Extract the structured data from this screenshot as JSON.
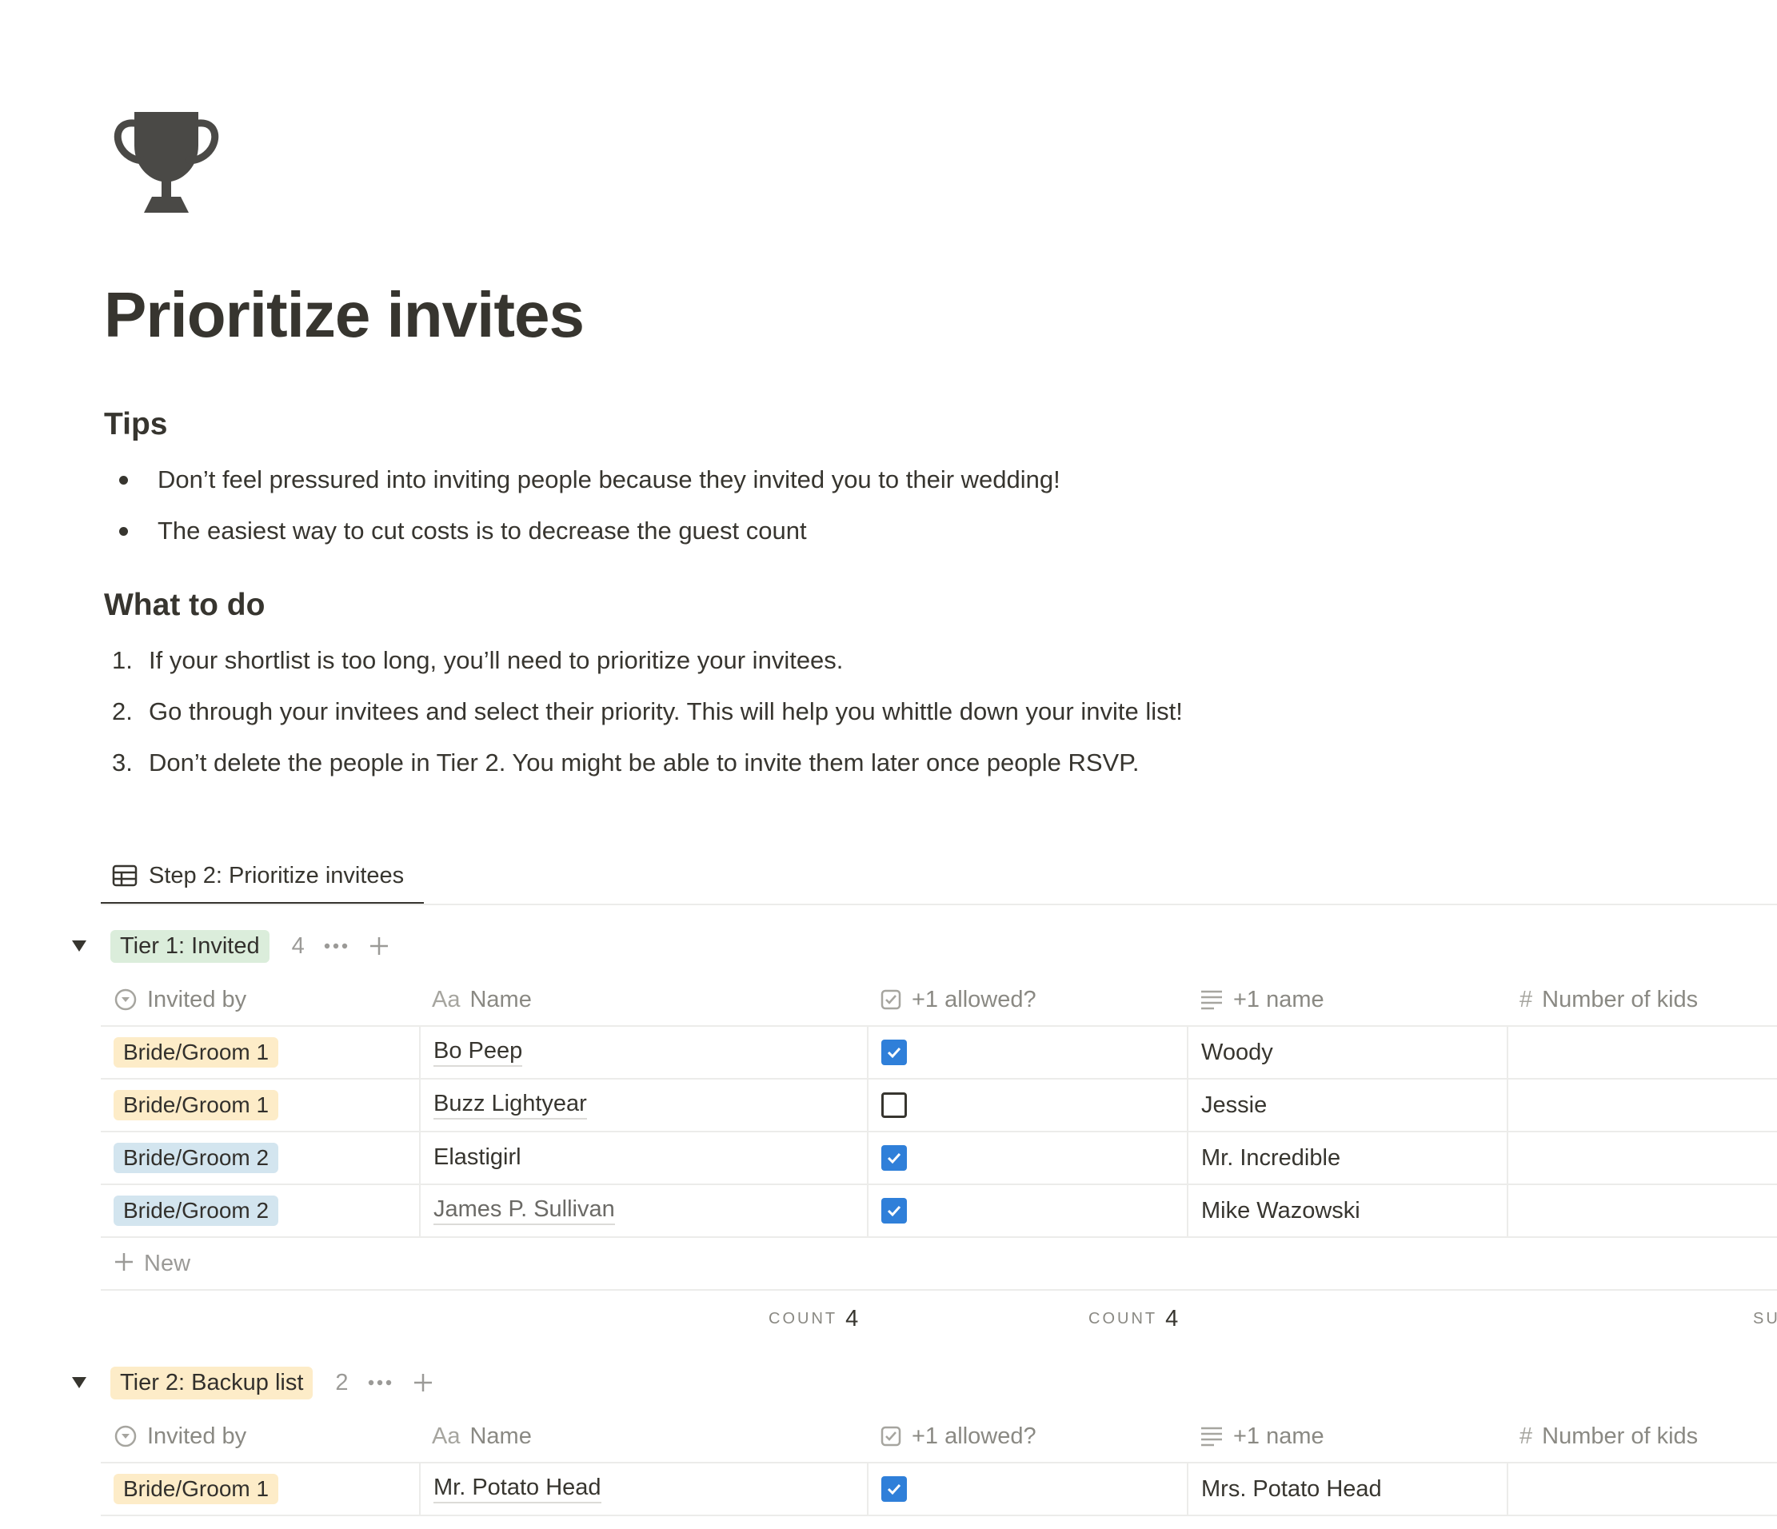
{
  "page": {
    "icon": "trophy-icon",
    "title": "Prioritize invites"
  },
  "tips": {
    "heading": "Tips",
    "items": [
      "Don’t feel pressured into inviting people because they invited you to their wedding!",
      "The easiest way to cut costs is to decrease the guest count"
    ]
  },
  "todo": {
    "heading": "What to do",
    "items": [
      {
        "marker": "1.",
        "text": "If your shortlist is too long, you’ll need to prioritize your invitees."
      },
      {
        "marker": "2.",
        "text": "Go through your invitees and select their priority. This will help you whittle down your invite list!"
      },
      {
        "marker": "3.",
        "text": "Don’t delete the people in Tier 2. You might be able to invite them later once people RSVP."
      }
    ]
  },
  "database": {
    "view_tab": "Step 2: Prioritize invitees",
    "view_icon": "table-icon",
    "columns": [
      {
        "icon": "select-icon",
        "icon_prefix": "",
        "label": "Invited by"
      },
      {
        "icon": "text-type-icon",
        "icon_prefix": "Aa",
        "label": "Name"
      },
      {
        "icon": "checkbox-icon",
        "icon_prefix": "",
        "label": "+1 allowed?"
      },
      {
        "icon": "lines-icon",
        "icon_prefix": "",
        "label": "+1 name"
      },
      {
        "icon": "hash-icon",
        "icon_prefix": "#",
        "label": "Number of kids"
      }
    ],
    "groups": [
      {
        "label": "Tier 1: Invited",
        "color": "#dbeddb",
        "count": "4",
        "rows": [
          {
            "invited_by": "Bride/Groom 1",
            "tag_color": "#fdecc8",
            "name": "Bo Peep",
            "plus_one": true,
            "plus_one_name": "Woody",
            "kids": ""
          },
          {
            "invited_by": "Bride/Groom 1",
            "tag_color": "#fdecc8",
            "name": "Buzz Lightyear",
            "plus_one": false,
            "plus_one_name": "Jessie",
            "kids": ""
          },
          {
            "invited_by": "Bride/Groom 2",
            "tag_color": "#d3e5ef",
            "name": "Elastigirl",
            "plus_one": true,
            "plus_one_name": "Mr. Incredible",
            "kids": ""
          },
          {
            "invited_by": "Bride/Groom 2",
            "tag_color": "#d3e5ef",
            "name": "James P. Sullivan",
            "plus_one": true,
            "plus_one_name": "Mike Wazowski",
            "kids": ""
          }
        ],
        "new_label": "New",
        "summaries": [
          {
            "label": "COUNT",
            "value": "4"
          },
          {
            "label": "COUNT",
            "value": "4"
          },
          {
            "label": "SU",
            "value": ""
          }
        ]
      },
      {
        "label": "Tier 2: Backup list",
        "color": "#fdecc8",
        "count": "2",
        "rows": [
          {
            "invited_by": "Bride/Groom 1",
            "tag_color": "#fdecc8",
            "name": "Mr. Potato Head",
            "plus_one": true,
            "plus_one_name": "Mrs. Potato Head",
            "kids": ""
          }
        ]
      }
    ]
  },
  "colors": {
    "text": "#37352f",
    "muted": "#9b9a97",
    "checkbox_checked": "#2f7fd9",
    "divider": "#ececea"
  }
}
